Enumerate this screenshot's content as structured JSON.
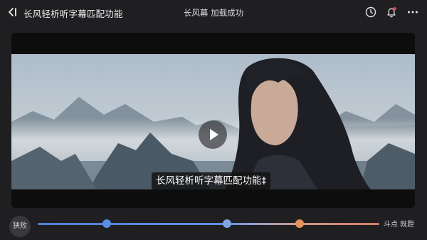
{
  "header": {
    "title": "长风轻析听字幕匹配功能",
    "status": "长风幕 加载成功"
  },
  "icons": {
    "back": "back-arrow-icon",
    "clock": "clock-icon",
    "bell": "notification-bell-icon",
    "more": "more-dots-icon",
    "play": "play-icon"
  },
  "player": {
    "subtitle": "长风轻析听字幕匹配功能‡"
  },
  "controls": {
    "switch_label": "狭败",
    "right_label": "斗点 既距"
  },
  "colors": {
    "background": "#1f1f21",
    "accent_blue": "#5a8ee4",
    "accent_orange": "#e0935c"
  }
}
